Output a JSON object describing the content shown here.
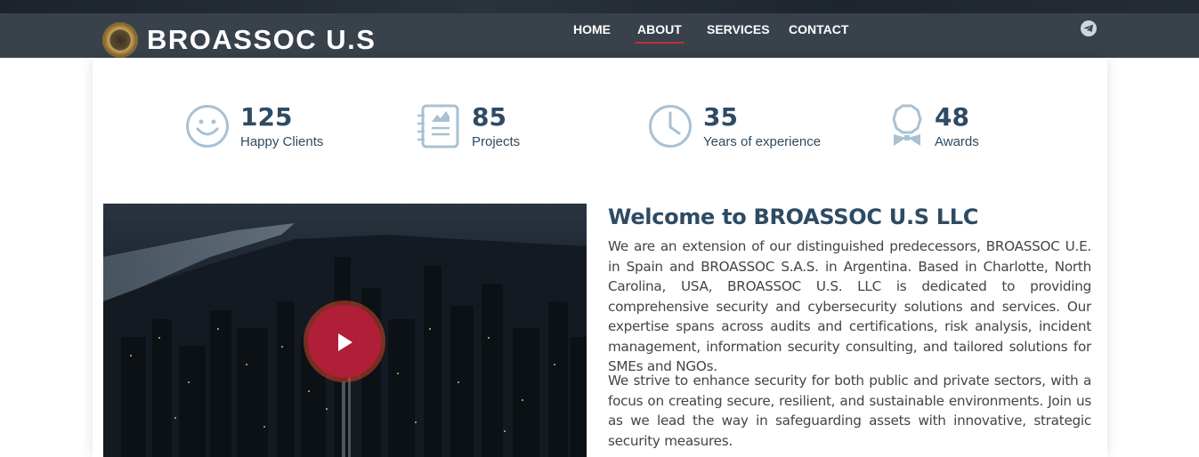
{
  "header": {
    "brand": "BROASSOC U.S",
    "nav": [
      {
        "label": "HOME",
        "active": false
      },
      {
        "label": "ABOUT",
        "active": true
      },
      {
        "label": "SERVICES",
        "active": false
      },
      {
        "label": "CONTACT",
        "active": false
      }
    ],
    "social_icon": "telegram-icon",
    "colors": {
      "header_bg": "#39424b",
      "active_underline": "#c0303d"
    }
  },
  "stats": [
    {
      "value": "125",
      "label": "Happy Clients",
      "icon": "smiley-icon"
    },
    {
      "value": "85",
      "label": "Projects",
      "icon": "notebook-icon"
    },
    {
      "value": "35",
      "label": "Years of experience",
      "icon": "clock-icon"
    },
    {
      "value": "48",
      "label": "Awards",
      "icon": "award-icon"
    }
  ],
  "video": {
    "icon": "play-icon",
    "colors": {
      "button": "#b01e37"
    }
  },
  "about": {
    "title": "Welcome to BROASSOC U.S LLC",
    "paragraphs": [
      "We are an extension of our distinguished predecessors, BROASSOC U.E. in Spain and BROASSOC S.A.S. in Argentina. Based in Charlotte, North Carolina, USA, BROASSOC U.S. LLC is dedicated to providing comprehensive security and cybersecurity solutions and services. Our expertise spans across audits and certifications, risk analysis, incident management, information security consulting, and tailored solutions for SMEs and NGOs.",
      "We strive to enhance security for both public and private sectors, with a focus on creating secure, resilient, and sustainable environments. Join us as we lead the way in safeguarding assets with innovative, strategic security measures."
    ]
  },
  "colors": {
    "heading": "#2e4b63",
    "icon_stroke": "#a9c1d3",
    "body_text": "#444444"
  }
}
